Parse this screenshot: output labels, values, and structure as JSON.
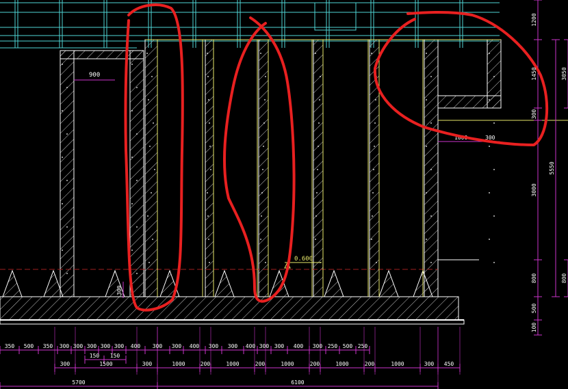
{
  "drawing": {
    "colors": {
      "background": "#000000",
      "wall_outline": "#ffffff",
      "hatch": "#c8c8c8",
      "inner_line": "#e8e86a",
      "grid": "#4fd6d6",
      "dimension": "#cc33cc",
      "dim_text": "#ffffff",
      "annotation": "#e82020",
      "level_mark": "#e8e86a",
      "dashed_line": "#a02020"
    },
    "callouts": {
      "top_left": "900",
      "level": "0.600",
      "small_300": "300",
      "right_1000": "1000",
      "right_300": "300"
    },
    "bottom_dims_row1": [
      "350",
      "500",
      "350",
      "300",
      "300",
      "300",
      "300",
      "300",
      "400",
      "300",
      "300",
      "400",
      "300",
      "300",
      "400",
      "300",
      "300",
      "400",
      "300",
      "250",
      "500",
      "250"
    ],
    "bottom_dims_row1b": [
      "150",
      "150"
    ],
    "bottom_dims_row2": [
      "300",
      "1500",
      "300",
      "1000",
      "200",
      "1000",
      "200",
      "1000",
      "200",
      "1000",
      "200",
      "1000",
      "300",
      "450"
    ],
    "bottom_dims_row3": [
      "5700",
      "6100"
    ],
    "right_dims": [
      "1200",
      "1450",
      "300",
      "5550",
      "3000",
      "800",
      "500",
      "100"
    ],
    "right_cutoff": [
      "3050",
      "800"
    ]
  }
}
